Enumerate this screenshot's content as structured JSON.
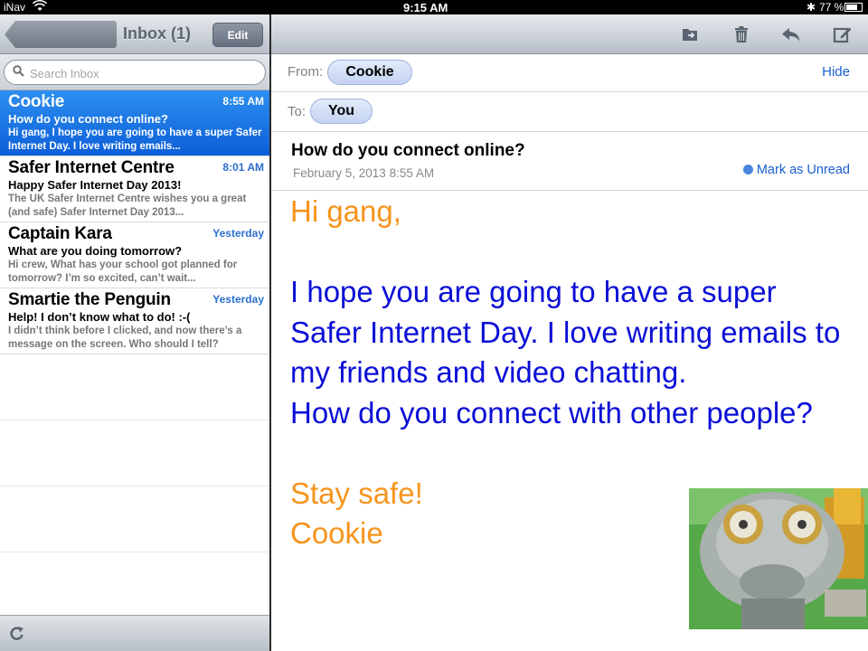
{
  "status_bar": {
    "carrier": "iNav",
    "time": "9:15 AM",
    "battery": "77 %",
    "battery_level": 0.77
  },
  "left_pane": {
    "inbox_title": "Inbox (1)",
    "edit_label": "Edit",
    "search_placeholder": "Search Inbox",
    "messages": [
      {
        "sender": "Cookie",
        "time": "8:55 AM",
        "subject": "How do you connect online?",
        "preview": "Hi gang, I hope you are going to have a super Safer Internet Day. I love writing emails...",
        "selected": true
      },
      {
        "sender": "Safer Internet Centre",
        "time": "8:01 AM",
        "subject": "Happy Safer Internet Day 2013!",
        "preview": "The UK Safer Internet Centre wishes you a great (and safe) Safer Internet Day 2013...",
        "selected": false
      },
      {
        "sender": "Captain Kara",
        "time": "Yesterday",
        "subject": "What are you doing tomorrow?",
        "preview": "Hi crew, What has your school got planned for tomorrow? I’m so excited, can’t wait...",
        "selected": false
      },
      {
        "sender": "Smartie the Penguin",
        "time": "Yesterday",
        "subject": "Help! I don’t know what to do! :-(",
        "preview": "I didn’t think before I clicked, and now there’s a message on the screen. Who should I tell?",
        "selected": false
      }
    ]
  },
  "message": {
    "from_label": "From:",
    "from": "Cookie",
    "hide_label": "Hide",
    "to_label": "To:",
    "to": "You",
    "subject": "How do you connect online?",
    "date": "February 5, 2013  8:55 AM",
    "mark_unread_label": "Mark as Unread",
    "body": {
      "greeting": "Hi gang,",
      "paragraph": "I hope you are going to have a super Safer Internet Day. I love writing emails to my friends and video chatting.",
      "question": "How do you connect with other people?",
      "signoff": "Stay safe!",
      "signature": "Cookie"
    }
  },
  "colors": {
    "selected_row": "#1a73e8",
    "link_blue": "#1a5fd0",
    "body_orange": "#f7941d",
    "body_blue": "#0b0fd6"
  },
  "icons": [
    "wifi-icon",
    "bluetooth-icon",
    "battery-icon",
    "search-icon",
    "move-folder-icon",
    "trash-icon",
    "reply-icon",
    "compose-icon",
    "refresh-icon"
  ]
}
